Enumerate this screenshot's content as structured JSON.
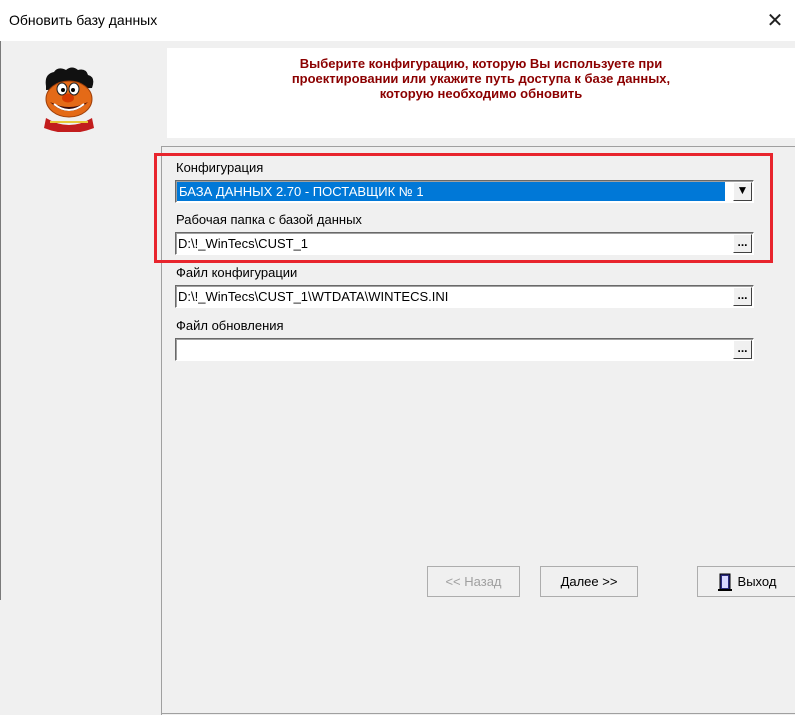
{
  "window": {
    "title": "Обновить базу данных",
    "close_glyph": "✕"
  },
  "banner": {
    "lines": [
      "Выберите конфигурацию, которую Вы используете при",
      "проектировании или укажите путь доступа к базе данных,",
      "которую необходимо обновить"
    ]
  },
  "form": {
    "config_label": "Конфигурация",
    "config_value": "БАЗА ДАННЫХ 2.70 - ПОСТАВЩИК № 1",
    "workdir_label": "Рабочая папка с базой данных",
    "workdir_value": "D:\\!_WinTecs\\CUST_1",
    "configfile_label": "Файл конфигурации",
    "configfile_value": "D:\\!_WinTecs\\CUST_1\\WTDATA\\WINTECS.INI",
    "updatefile_label": "Файл обновления",
    "updatefile_value": "",
    "browse_glyph": "...",
    "dropdown_glyph": "▼"
  },
  "buttons": {
    "back": "<< Назад",
    "next": "Далее >>",
    "exit": "Выход"
  },
  "colors": {
    "highlight": "#e8252d",
    "banner_text": "#8b0000",
    "selection": "#0078d7"
  },
  "icons": [
    "close-icon",
    "mascot-face-icon",
    "dropdown-arrow-icon",
    "browse-icon",
    "exit-door-icon"
  ]
}
